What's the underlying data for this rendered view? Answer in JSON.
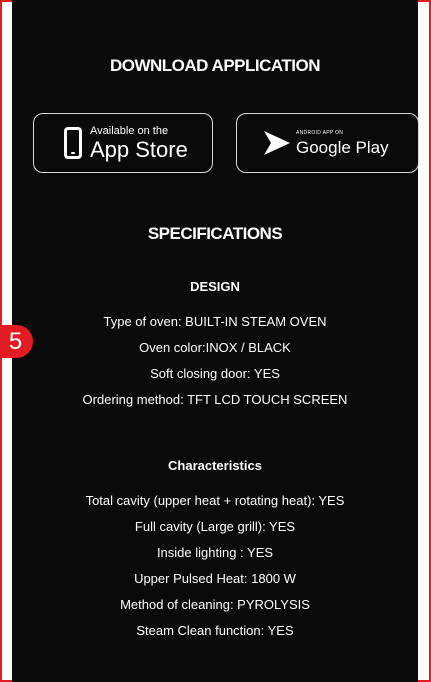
{
  "badge": "5",
  "download": {
    "title": "DOWNLOAD APPLICATION",
    "appstore": {
      "small": "Available on the",
      "big": "App Store",
      "icon": "phone-icon"
    },
    "googleplay": {
      "small": "ANDROID APP ON",
      "big": "Google Play",
      "icon": "play-icon"
    }
  },
  "specs": {
    "title": "SPECIFICATIONS",
    "design": {
      "title": "DESIGN",
      "items": [
        "Type of oven: BUILT-IN STEAM OVEN",
        "Oven color:INOX / BLACK",
        "Soft closing door: YES",
        "Ordering method: TFT LCD TOUCH SCREEN"
      ]
    },
    "characteristics": {
      "title": "Characteristics",
      "items": [
        "Total cavity (upper heat + rotating heat): YES",
        "Full cavity (Large grill): YES",
        "Inside lighting : YES",
        "Upper Pulsed Heat: 1800 W",
        "Method of cleaning: PYROLYSIS",
        "Steam Clean function: YES"
      ]
    }
  },
  "colors": {
    "accent": "#e31b23",
    "panel": "#0a0a0a"
  }
}
